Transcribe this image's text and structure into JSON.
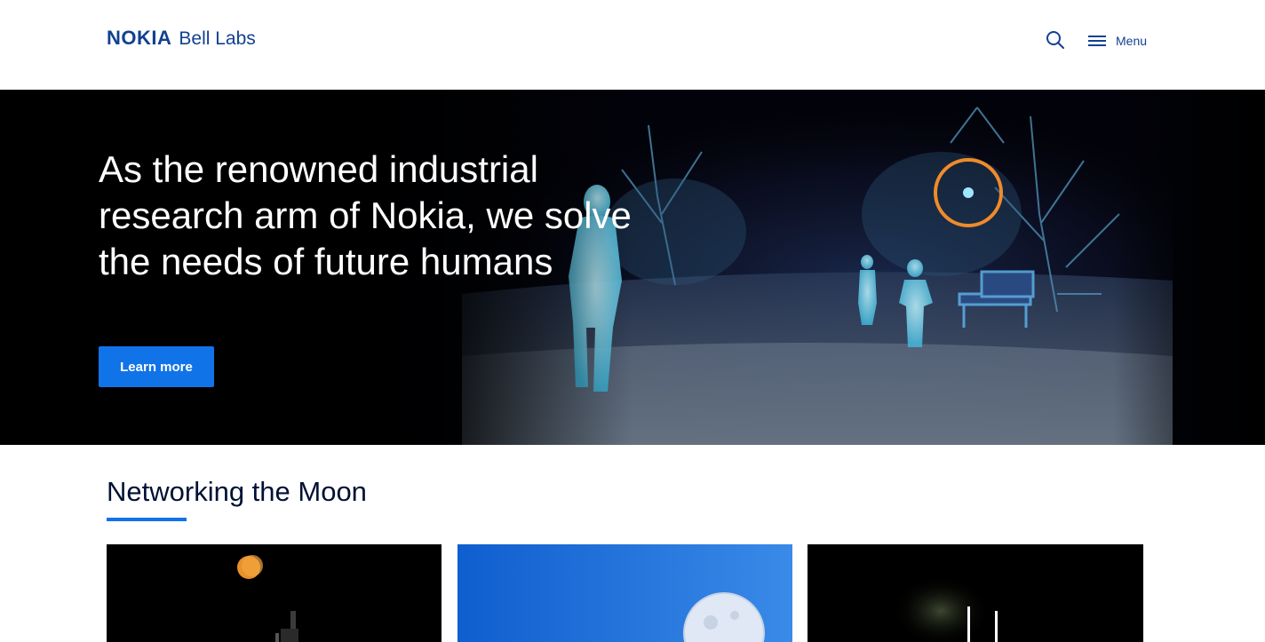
{
  "header": {
    "brand_name": "NOKIA",
    "brand_sub": "Bell Labs",
    "search_icon": "search-icon",
    "menu_icon": "hamburger-menu-icon",
    "menu_label": "Menu"
  },
  "hero": {
    "title": "As the renowned industrial research arm of Nokia, we solve the needs of future humans",
    "cta_label": "Learn more"
  },
  "section": {
    "title": "Networking the Moon",
    "cards": [
      {
        "image": "moon-over-launch-tower"
      },
      {
        "image": "moon-in-blue-sky"
      },
      {
        "image": "lunar-surface-lights"
      }
    ]
  },
  "colors": {
    "brand": "#124191",
    "accent": "#1173e8",
    "hero_bg": "#000000"
  }
}
